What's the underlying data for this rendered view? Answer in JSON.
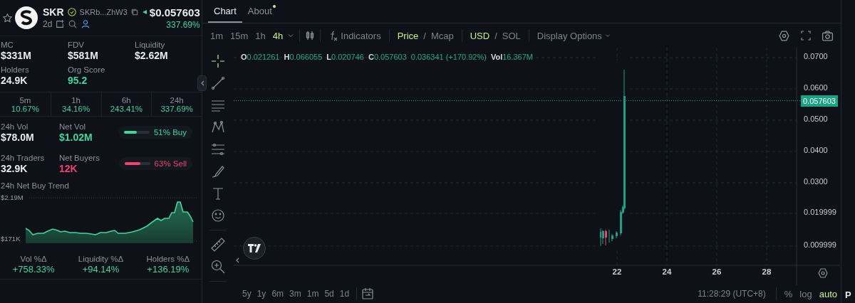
{
  "token": {
    "favorite": false,
    "symbol": "SKR",
    "verified": true,
    "address": "SKRb...ZhW3",
    "age": "2d",
    "price": "$0.057603",
    "change": "337.69%"
  },
  "stats": [
    {
      "label": "MC",
      "value": "$331M"
    },
    {
      "label": "FDV",
      "value": "$581M"
    },
    {
      "label": "Liquidity",
      "value": "$2.62M"
    },
    {
      "label": "Holders",
      "value": "24.9K"
    },
    {
      "label": "Org Score",
      "value": "95.2",
      "color": "#3fd69b"
    }
  ],
  "changes": [
    {
      "period": "5m",
      "value": "10.67%"
    },
    {
      "period": "1h",
      "value": "34.16%"
    },
    {
      "period": "6h",
      "value": "243.41%"
    },
    {
      "period": "24h",
      "value": "337.69%"
    }
  ],
  "flow_rows": [
    {
      "metric": {
        "label": "24h Vol",
        "value": "$78.0M"
      },
      "net": {
        "label": "Net Vol",
        "value": "$1.02M",
        "color": "#3fd69b"
      },
      "pressure": {
        "text": "51% Buy",
        "color": "#3fd69b",
        "level": 0.51
      }
    },
    {
      "metric": {
        "label": "24h Traders",
        "value": "32.9K"
      },
      "net": {
        "label": "Net Buyers",
        "value": "12K",
        "color": "#f2426e"
      },
      "pressure": {
        "text": "63% Sell",
        "color": "#f2426e",
        "level": 0.63
      }
    }
  ],
  "trend": {
    "title": "24h Net Buy Trend",
    "high": "$2.19M",
    "low": "$171K"
  },
  "deltas": [
    {
      "label": "Vol %Δ",
      "value": "+758.33%"
    },
    {
      "label": "Liquidity %Δ",
      "value": "+94.14%"
    },
    {
      "label": "Holders %Δ",
      "value": "+136.19%"
    }
  ],
  "tabs": [
    {
      "label": "Chart",
      "selected": true,
      "dot": false
    },
    {
      "label": "About",
      "selected": false,
      "dot": true
    }
  ],
  "intervals": [
    {
      "label": "1m",
      "selected": false
    },
    {
      "label": "15m",
      "selected": false
    },
    {
      "label": "1h",
      "selected": false
    },
    {
      "label": "4h",
      "selected": true
    }
  ],
  "indicators": "Indicators",
  "separator": "/",
  "price_mode": [
    {
      "label": "Price",
      "selected": true
    },
    {
      "label": "Mcap",
      "selected": false
    }
  ],
  "currency": [
    {
      "label": "USD",
      "selected": true
    },
    {
      "label": "SOL",
      "selected": false
    }
  ],
  "display_options": "Display Options",
  "legend": {
    "fields": [
      {
        "key": "O",
        "value": "0.021261"
      },
      {
        "key": "H",
        "value": "0.066055"
      },
      {
        "key": "L",
        "value": "0.020746"
      },
      {
        "key": "C",
        "value": "0.057603"
      }
    ],
    "change": "0.036341 (+170.92%)",
    "volume": {
      "key": "Vol",
      "value": "16.367M"
    }
  },
  "price_axis": [
    "0.0700",
    "0.0600",
    "0.0500",
    "0.0400",
    "0.0300",
    "0.019999",
    "0.009999"
  ],
  "last_price": "0.057603",
  "time_axis": [
    "22",
    "24",
    "26",
    "28"
  ],
  "ranges": [
    "5y",
    "1y",
    "6m",
    "3m",
    "1m",
    "5d",
    "1d"
  ],
  "clock": "11:28:29 (UTC+8)",
  "scale_options": [
    {
      "label": "%",
      "selected": false
    },
    {
      "label": "log",
      "selected": false
    },
    {
      "label": "auto",
      "selected": true
    }
  ],
  "side_panel_label": "P"
}
